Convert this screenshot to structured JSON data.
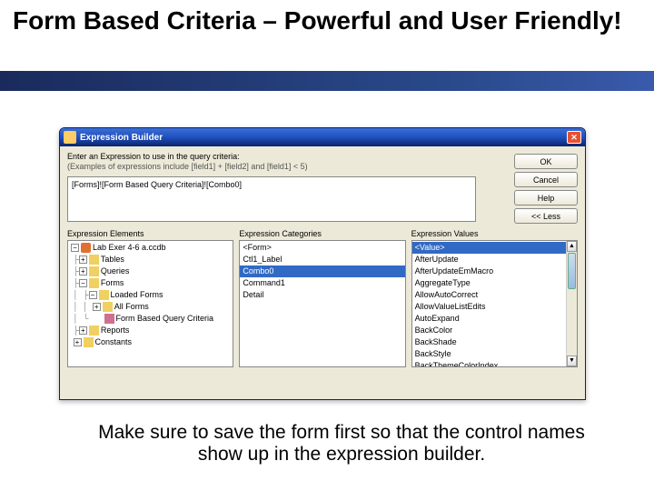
{
  "slide": {
    "title": "Form Based Criteria – Powerful and User Friendly!",
    "caption": "Make sure to save the form first so that the control names show up in the expression builder."
  },
  "dialog": {
    "title": "Expression Builder",
    "prompt": "Enter an Expression to use in the query criteria:",
    "example": "(Examples of expressions include [field1] + [field2] and [field1] < 5)",
    "expression": "[Forms]![Form Based Query Criteria]![Combo0]",
    "buttons": {
      "ok": "OK",
      "cancel": "Cancel",
      "help": "Help",
      "less": "<< Less"
    },
    "columns": {
      "elements_label": "Expression Elements",
      "categories_label": "Expression Categories",
      "values_label": "Expression Values"
    },
    "tree": {
      "root": "Lab Exer 4-6 a.ccdb",
      "tables": "Tables",
      "queries": "Queries",
      "forms": "Forms",
      "loaded": "Loaded Forms",
      "allforms": "All Forms",
      "current_form": "Form Based Query Criteria",
      "reports": "Reports",
      "constants": "Constants"
    },
    "categories": [
      "<Form>",
      "Ctl1_Label",
      "Combo0",
      "Command1",
      "Detail"
    ],
    "categories_selected": "Combo0",
    "values": [
      "<Value>",
      "AfterUpdate",
      "AfterUpdateEmMacro",
      "AggregateType",
      "AllowAutoCorrect",
      "AllowValueListEdits",
      "AutoExpand",
      "BackColor",
      "BackShade",
      "BackStyle",
      "BackThemeColorIndex"
    ],
    "values_selected": "<Value>"
  }
}
